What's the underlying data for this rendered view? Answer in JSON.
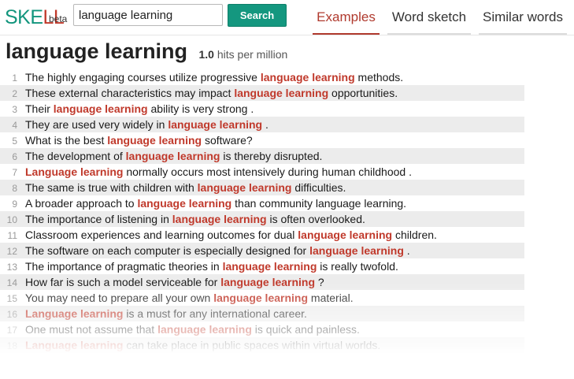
{
  "header": {
    "logo": {
      "prefix": "SKE",
      "ll": "LL",
      "beta": "beta"
    },
    "search": {
      "value": "language learning",
      "button_label": "Search"
    },
    "tabs": [
      {
        "label": "Examples",
        "active": true
      },
      {
        "label": "Word sketch",
        "active": false
      },
      {
        "label": "Similar words",
        "active": false
      }
    ]
  },
  "main": {
    "title": "language learning",
    "hits_value": "1.0",
    "hits_text": "hits per million",
    "keyword_color": "#c0392b",
    "examples": [
      {
        "n": "1",
        "before": "The highly engaging courses utilize progressive ",
        "kw": "language learning",
        "after": " methods."
      },
      {
        "n": "2",
        "before": "These external characteristics may impact ",
        "kw": "language learning",
        "after": " opportunities."
      },
      {
        "n": "3",
        "before": "Their ",
        "kw": "language learning",
        "after": " ability is very strong ."
      },
      {
        "n": "4",
        "before": "They are used very widely in ",
        "kw": "language learning",
        "after": " ."
      },
      {
        "n": "5",
        "before": "What is the best ",
        "kw": "language learning",
        "after": " software?"
      },
      {
        "n": "6",
        "before": "The development of ",
        "kw": "language learning",
        "after": " is thereby disrupted."
      },
      {
        "n": "7",
        "before": "",
        "kw": "Language learning",
        "after": " normally occurs most intensively during human childhood ."
      },
      {
        "n": "8",
        "before": "The same is true with children with ",
        "kw": "language learning",
        "after": " difficulties."
      },
      {
        "n": "9",
        "before": "A broader approach to ",
        "kw": "language learning",
        "after": " than community language learning."
      },
      {
        "n": "10",
        "before": "The importance of listening in ",
        "kw": "language learning",
        "after": " is often overlooked."
      },
      {
        "n": "11",
        "before": "Classroom experiences and learning outcomes for dual ",
        "kw": "language learning",
        "after": " children."
      },
      {
        "n": "12",
        "before": "The software on each computer is especially designed for ",
        "kw": "language learning",
        "after": " ."
      },
      {
        "n": "13",
        "before": "The importance of pragmatic theories in ",
        "kw": "language learning",
        "after": " is really twofold."
      },
      {
        "n": "14",
        "before": "How far is such a model serviceable for ",
        "kw": "language learning",
        "after": " ?"
      },
      {
        "n": "15",
        "before": "You may need to prepare all your own ",
        "kw": "language learning",
        "after": " material."
      },
      {
        "n": "16",
        "before": "",
        "kw": "Language learning",
        "after": " is a must for any international career."
      },
      {
        "n": "17",
        "before": "One must not assume that ",
        "kw": "language learning",
        "after": " is quick and painless."
      },
      {
        "n": "18",
        "before": "",
        "kw": "Language learning",
        "after": " can take place in public spaces within virtual worlds."
      }
    ]
  }
}
